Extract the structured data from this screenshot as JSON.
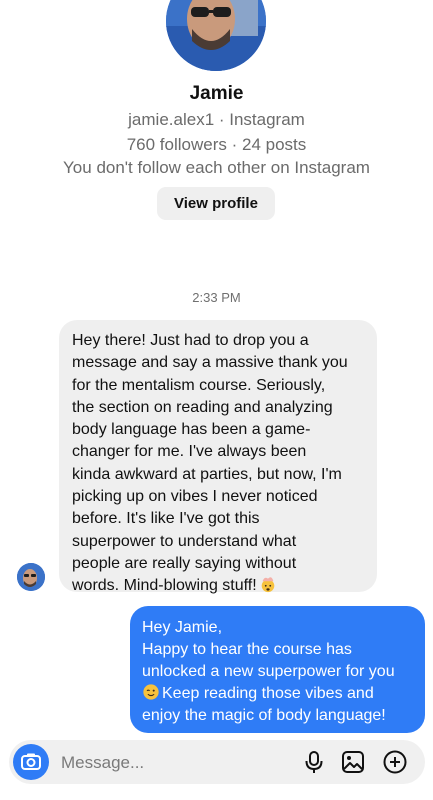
{
  "profile": {
    "name": "Jamie",
    "handle_line": "jamie.alex1 · Instagram",
    "stats_line": "760 followers · 24 posts",
    "mutual_line": "You don't follow each other on Instagram",
    "view_profile_label": "View profile"
  },
  "thread": {
    "timestamp": "2:33 PM",
    "incoming": {
      "lines": [
        "Hey there! Just had to drop you a",
        "message and say a massive thank you",
        "for the mentalism course. Seriously,",
        "the section on reading and analyzing",
        "body language has been a game-",
        "changer for me. I've always been",
        "kinda awkward at parties, but now, I'm",
        "picking up on vibes I never noticed",
        "before. It's like I've got this",
        "superpower to understand what",
        "people are really saying without",
        "words. Mind-blowing stuff!"
      ],
      "emoji": "exploding-head"
    },
    "outgoing": {
      "lines": [
        "Hey Jamie,",
        "Happy to hear the course has",
        "unlocked a new superpower for you",
        "Keep reading those vibes and",
        "enjoy the magic of body language!"
      ],
      "emoji": "winking-face"
    }
  },
  "composer": {
    "placeholder": "Message..."
  },
  "colors": {
    "accent": "#2f7cf6",
    "incoming_bubble": "#efefef",
    "secondary_text": "#6b6b6b"
  }
}
